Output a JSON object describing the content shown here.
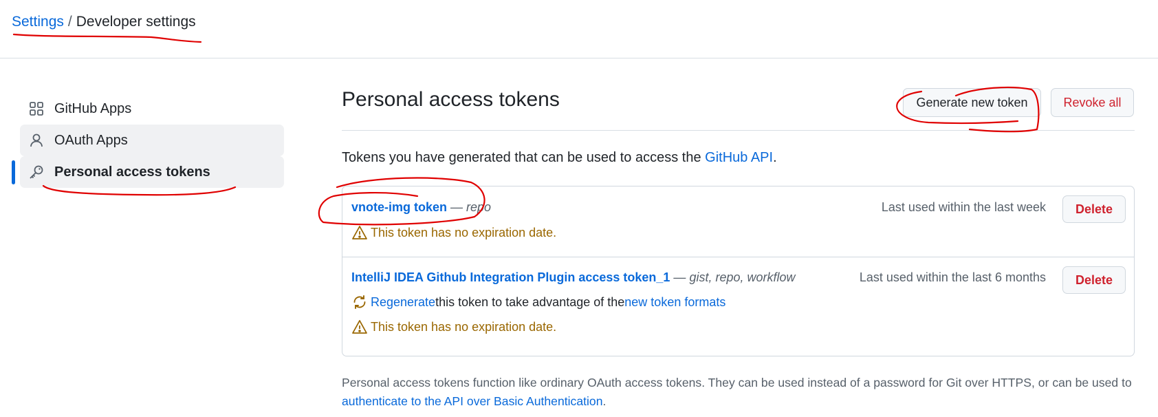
{
  "breadcrumb": {
    "root": "Settings",
    "separator": "/",
    "current": "Developer settings"
  },
  "sidebar": {
    "items": [
      {
        "label": "GitHub Apps",
        "icon": "apps-grid-icon",
        "state": "default"
      },
      {
        "label": "OAuth Apps",
        "icon": "person-icon",
        "state": "hover"
      },
      {
        "label": "Personal access tokens",
        "icon": "key-icon",
        "state": "active"
      }
    ]
  },
  "main": {
    "title": "Personal access tokens",
    "generate_label": "Generate new token",
    "revoke_label": "Revoke all",
    "intro_text": "Tokens you have generated that can be used to access the ",
    "intro_link": "GitHub API",
    "intro_end": ".",
    "tokens": [
      {
        "name": "vnote-img token",
        "dash": " — ",
        "scopes": "repo",
        "last_used": "Last used within the last week",
        "delete_label": "Delete",
        "warning": "This token has no expiration date."
      },
      {
        "name": "IntelliJ IDEA Github Integration Plugin access token_1",
        "dash": " — ",
        "scopes": "gist, repo, workflow",
        "last_used": "Last used within the last 6 months",
        "delete_label": "Delete",
        "regen_link": "Regenerate",
        "regen_text": " this token to take advantage of the ",
        "regen_link2": "new token formats",
        "warning": "This token has no expiration date."
      }
    ],
    "footnote_text": "Personal access tokens function like ordinary OAuth access tokens. They can be used instead of a password for Git over HTTPS, or can be used to ",
    "footnote_link": "authenticate to the API over Basic Authentication",
    "footnote_end": "."
  },
  "colors": {
    "link": "#0969da",
    "danger": "#cf222e",
    "warning": "#9a6700",
    "annotation": "#e00000"
  }
}
